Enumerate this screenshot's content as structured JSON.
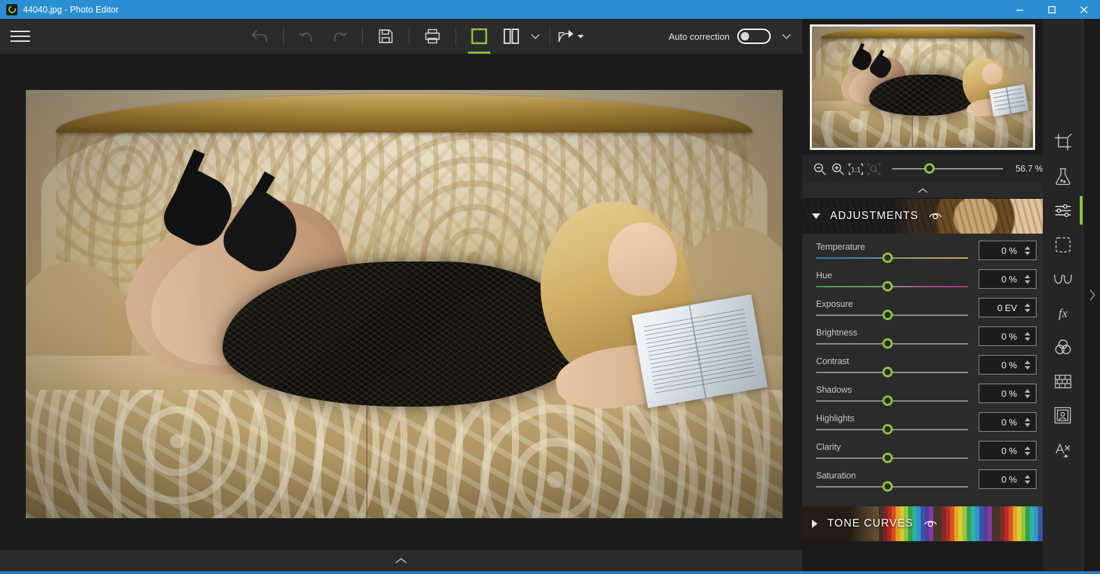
{
  "window": {
    "title": "44040.jpg - Photo Editor",
    "app_icon": "photo-editor-icon",
    "minimize_label": "Minimize",
    "maximize_label": "Maximize",
    "close_label": "Close"
  },
  "toolbar": {
    "menu_label": "Menu",
    "buttons": [
      {
        "name": "revert-button",
        "icon": "revert-arrow-icon",
        "enabled": false
      },
      {
        "name": "undo-button",
        "icon": "undo-icon",
        "enabled": false
      },
      {
        "name": "redo-button",
        "icon": "redo-icon",
        "enabled": false
      },
      {
        "name": "save-button",
        "icon": "save-floppy-icon",
        "enabled": true
      },
      {
        "name": "print-button",
        "icon": "printer-icon",
        "enabled": true
      },
      {
        "name": "single-view-button",
        "icon": "single-pane-icon",
        "enabled": true,
        "active": true
      },
      {
        "name": "split-view-button",
        "icon": "split-pane-icon",
        "enabled": true
      },
      {
        "name": "view-options-dropdown",
        "icon": "chevron-down-icon",
        "enabled": true
      },
      {
        "name": "share-button",
        "icon": "share-icon",
        "enabled": true
      }
    ],
    "auto_correction_label": "Auto correction",
    "auto_correction_on": false,
    "auto_correction_dropdown_icon": "chevron-down-icon"
  },
  "canvas": {
    "image_name": "44040.jpg",
    "bottom_expander_icon": "chevron-up-icon"
  },
  "navigator": {
    "collapse_icon": "chevron-up-icon",
    "zoom": {
      "zoom_out_icon": "zoom-out-icon",
      "zoom_in_icon": "zoom-in-icon",
      "actual_size_icon": "one-to-one-icon",
      "fit_icon": "fit-to-window-icon",
      "value": "56.7 %",
      "slider_percent": 33
    }
  },
  "panels": [
    {
      "id": "adjustments",
      "title": "ADJUSTMENTS",
      "expanded": true,
      "toggle_icon": "triangle-down-icon",
      "visibility_icon": "eye-icon",
      "background": "gears-photo"
    },
    {
      "id": "tone-curves",
      "title": "TONE CURVES",
      "expanded": false,
      "toggle_icon": "triangle-right-icon",
      "visibility_icon": "eye-icon",
      "background": "colored-pencils-photo"
    }
  ],
  "adjustments": [
    {
      "label": "Temperature",
      "value": "0 %",
      "track": "temperature",
      "handle_percent": 47
    },
    {
      "label": "Hue",
      "value": "0 %",
      "track": "hue",
      "handle_percent": 47
    },
    {
      "label": "Exposure",
      "value": "0 EV",
      "track": "plain",
      "handle_percent": 47
    },
    {
      "label": "Brightness",
      "value": "0 %",
      "track": "plain",
      "handle_percent": 47
    },
    {
      "label": "Contrast",
      "value": "0 %",
      "track": "plain",
      "handle_percent": 47
    },
    {
      "label": "Shadows",
      "value": "0 %",
      "track": "plain",
      "handle_percent": 47
    },
    {
      "label": "Highlights",
      "value": "0 %",
      "track": "plain",
      "handle_percent": 47
    },
    {
      "label": "Clarity",
      "value": "0 %",
      "track": "plain",
      "handle_percent": 47
    },
    {
      "label": "Saturation",
      "value": "0 %",
      "track": "plain",
      "handle_percent": 47
    }
  ],
  "tool_rail": [
    {
      "name": "crop-tool",
      "icon": "crop-icon",
      "active": false
    },
    {
      "name": "effects-tool",
      "icon": "flask-icon",
      "active": false
    },
    {
      "name": "adjustments-tool",
      "icon": "sliders-icon",
      "active": true
    },
    {
      "name": "selection-tool",
      "icon": "marquee-icon",
      "active": false
    },
    {
      "name": "retouch-tool",
      "icon": "glasses-icon",
      "active": false
    },
    {
      "name": "fx-tool",
      "icon": "fx-icon",
      "active": false
    },
    {
      "name": "color-tool",
      "icon": "color-circles-icon",
      "active": false
    },
    {
      "name": "texture-tool",
      "icon": "brick-wall-icon",
      "active": false
    },
    {
      "name": "frame-tool",
      "icon": "portrait-frame-icon",
      "active": false
    },
    {
      "name": "text-tool",
      "icon": "text-art-icon",
      "active": false
    }
  ],
  "rail_expander_icon": "chevron-right-icon",
  "colors": {
    "accent_green": "#8cc63f",
    "title_blue": "#2a8fd0",
    "panel_bg": "#2b2b2b",
    "app_bg": "#1e1e1e"
  }
}
